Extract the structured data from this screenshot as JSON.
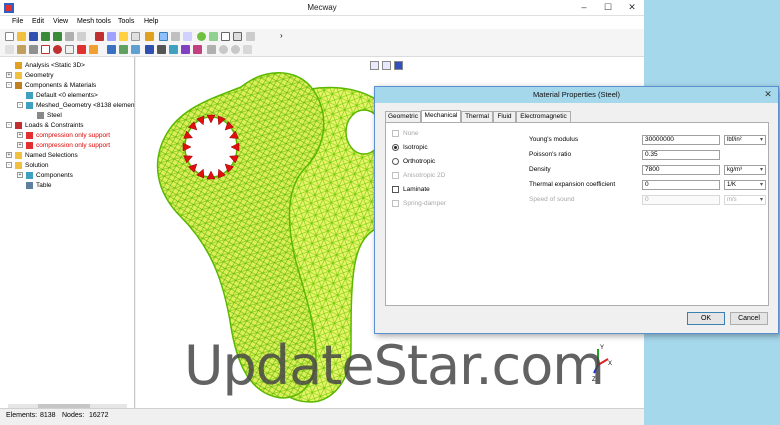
{
  "window": {
    "title": "Mecway"
  },
  "menu": [
    "File",
    "Edit",
    "View",
    "Mesh tools",
    "Tools",
    "Help"
  ],
  "tree": {
    "items": [
      {
        "label": "Analysis <Static 3D>",
        "level": 0,
        "icon": "pencil-icon",
        "expander": ""
      },
      {
        "label": "Geometry",
        "level": 0,
        "icon": "folder-icon",
        "expander": "+"
      },
      {
        "label": "Components & Materials",
        "level": 0,
        "icon": "materials-icon",
        "expander": "-"
      },
      {
        "label": "Default <0 elements>",
        "level": 1,
        "icon": "component-icon",
        "expander": ""
      },
      {
        "label": "Meshed_Geometry <8138 elemen",
        "level": 1,
        "icon": "component-icon",
        "expander": "-"
      },
      {
        "label": "Steel",
        "level": 2,
        "icon": "material-icon",
        "expander": ""
      },
      {
        "label": "Loads & Constraints",
        "level": 0,
        "icon": "loads-icon",
        "expander": "-"
      },
      {
        "label": "compression only support",
        "level": 1,
        "icon": "support-icon",
        "expander": "+",
        "color": "#e00000"
      },
      {
        "label": "compression only support",
        "level": 1,
        "icon": "support-icon",
        "expander": "+",
        "color": "#e00000"
      },
      {
        "label": "Named Selections",
        "level": 0,
        "icon": "folder-icon",
        "expander": "+"
      },
      {
        "label": "Solution",
        "level": 0,
        "icon": "folder-icon",
        "expander": "-"
      },
      {
        "label": "Components",
        "level": 1,
        "icon": "components-icon",
        "expander": "+"
      },
      {
        "label": "Table",
        "level": 1,
        "icon": "table-icon",
        "expander": ""
      }
    ]
  },
  "status": {
    "elements_label": "Elements:",
    "elements_value": "8138",
    "nodes_label": "Nodes:",
    "nodes_value": "16272"
  },
  "dialog": {
    "title": "Material Properties (Steel)",
    "close": "✕",
    "tabs": [
      "Geometric",
      "Mechanical",
      "Thermal",
      "Fluid",
      "Electromagnetic"
    ],
    "active_tab": "Mechanical",
    "options": [
      {
        "label": "None",
        "type": "check",
        "checked": false,
        "disabled": true
      },
      {
        "label": "Isotropic",
        "type": "radio",
        "checked": true,
        "disabled": false
      },
      {
        "label": "Orthotropic",
        "type": "radio",
        "checked": false,
        "disabled": false
      },
      {
        "label": "Anisotropic 2D",
        "type": "check",
        "checked": false,
        "disabled": true
      },
      {
        "label": "Laminate",
        "type": "check",
        "checked": false,
        "disabled": false
      },
      {
        "label": "Spring-damper",
        "type": "check",
        "checked": false,
        "disabled": true
      }
    ],
    "properties": [
      {
        "label": "Young's modulus",
        "value": "30000000",
        "unit": "lbf/in²",
        "disabled": false
      },
      {
        "label": "Poisson's ratio",
        "value": "0.35",
        "unit": "",
        "disabled": false
      },
      {
        "label": "Density",
        "value": "7800",
        "unit": "kg/m³",
        "disabled": false
      },
      {
        "label": "Thermal expansion coefficient",
        "value": "0",
        "unit": "1/K",
        "disabled": false
      },
      {
        "label": "Speed of sound",
        "value": "0",
        "unit": "m/s",
        "disabled": true
      }
    ],
    "ok": "OK",
    "cancel": "Cancel"
  },
  "axis": {
    "x": "X",
    "y": "Y",
    "z": "Z"
  },
  "watermark": "UpdateStar.com",
  "colors": {
    "mesh": "#7cd400",
    "mesh_fill": "#e7f46a",
    "constraint": "#e01010",
    "accent": "#3c7fb1"
  }
}
